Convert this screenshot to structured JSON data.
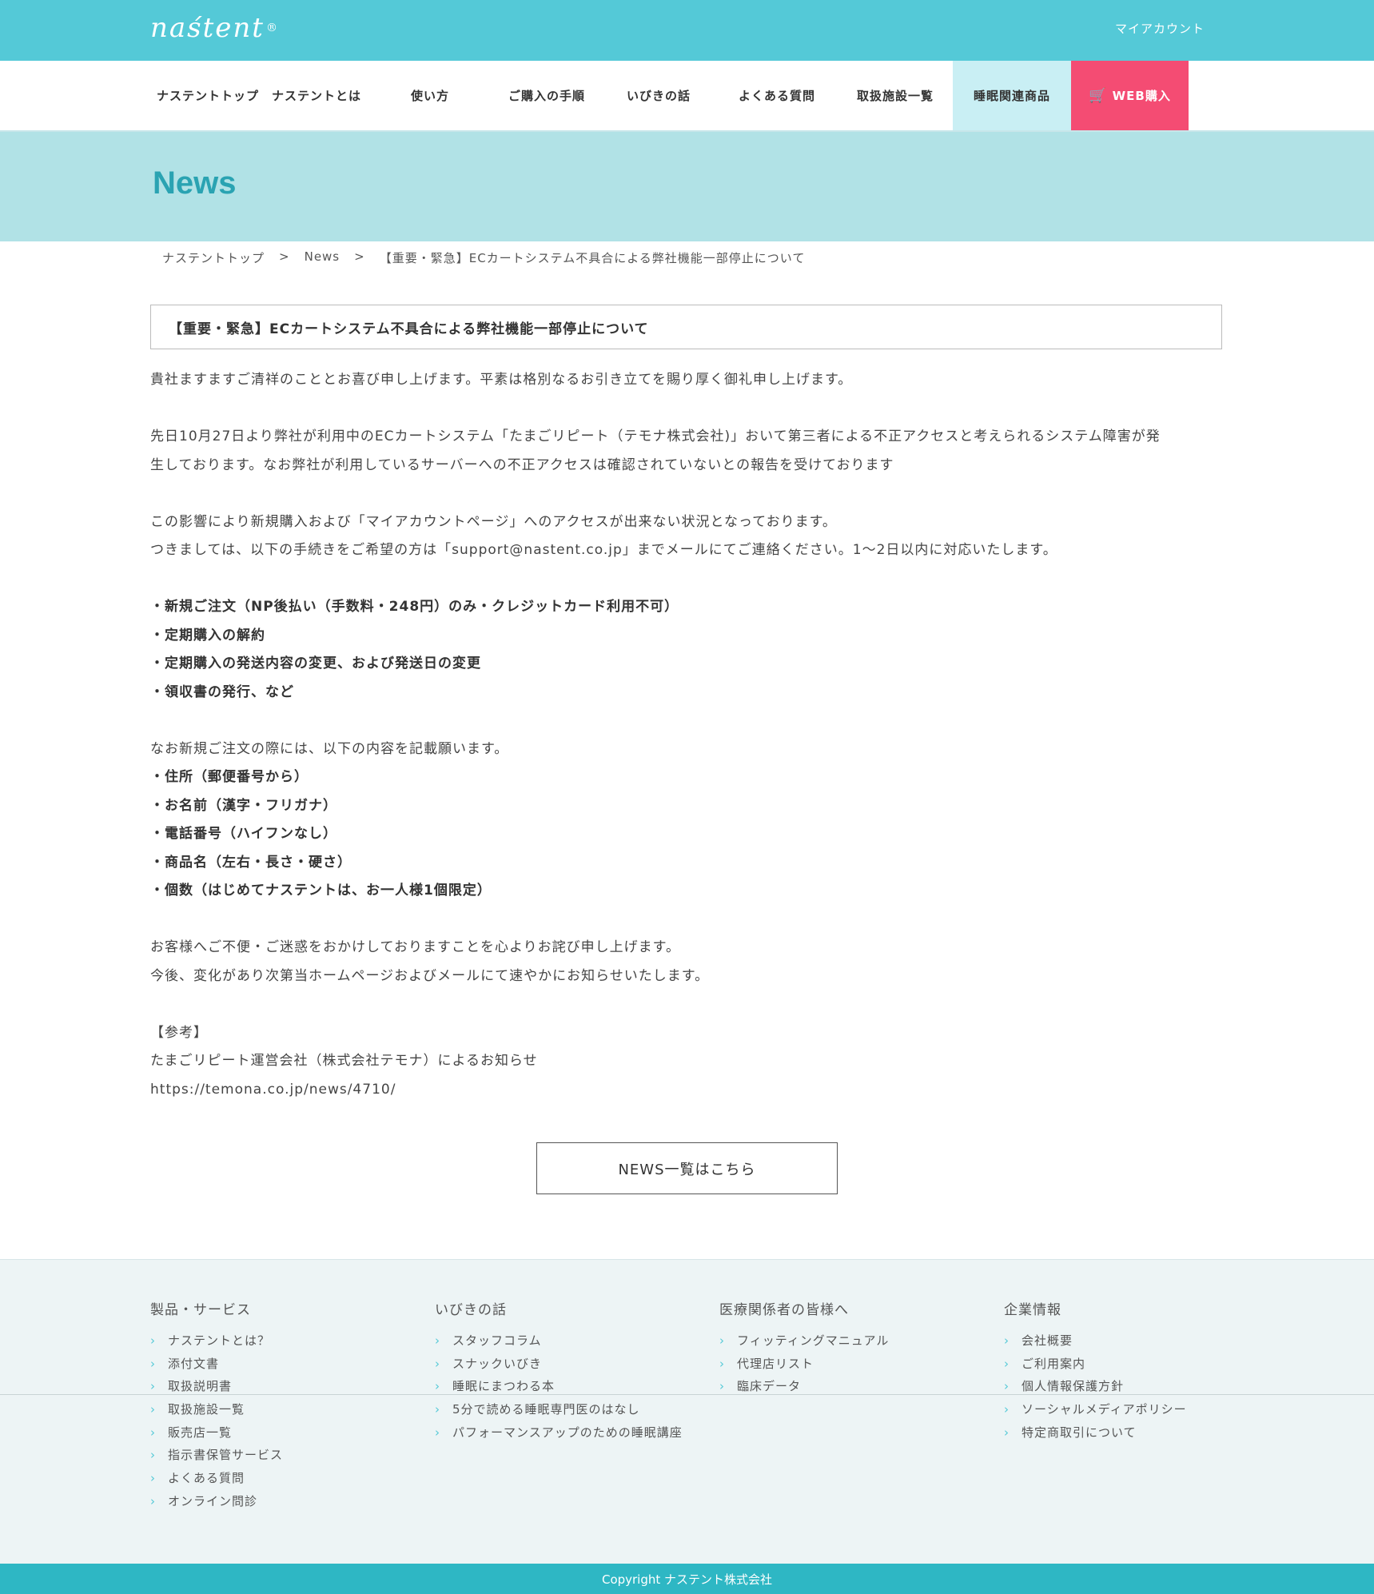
{
  "header": {
    "logo_text": "naśtent",
    "logo_mark": "®",
    "my_account": "マイアカウント"
  },
  "nav": {
    "items": [
      "ナステントトップ",
      "ナステントとは",
      "使い方",
      "ご購入の手順",
      "いびきの話",
      "よくある質問",
      "取扱施設一覧",
      "睡眠関連商品",
      "WEB購入"
    ]
  },
  "hero": {
    "title": "News"
  },
  "breadcrumb": {
    "items": [
      "ナステントトップ",
      "News",
      "【重要・緊急】ECカートシステム不具合による弊社機能一部停止について"
    ],
    "separator": ">"
  },
  "article": {
    "title": "【重要・緊急】ECカートシステム不具合による弊社機能一部停止について",
    "p1": "貴社ますますご清祥のこととお喜び申し上げます。平素は格別なるお引き立てを賜り厚く御礼申し上げます。",
    "p2a": "先日10月27日より弊社が利用中のECカートシステム「たまごリピート（テモナ株式会社)」おいて第三者による不正アクセスと考えられるシステム障害が発",
    "p2b": "生しております。なお弊社が利用しているサーバーへの不正アクセスは確認されていないとの報告を受けております",
    "p3a": "この影響により新規購入および「マイアカウントページ」へのアクセスが出来ない状況となっております。",
    "p3b": "つきましては、以下の手続きをご希望の方は「support@nastent.co.jp」までメールにてご連絡ください。1〜2日以内に対応いたします。",
    "list1": [
      "・新規ご注文（NP後払い（手数料・248円）のみ・クレジットカード利用不可）",
      "・定期購入の解約",
      "・定期購入の発送内容の変更、および発送日の変更",
      "・領収書の発行、など"
    ],
    "p4": "なお新規ご注文の際には、以下の内容を記載願います。",
    "list2": [
      "・住所（郵便番号から）",
      "・お名前（漢字・フリガナ）",
      "・電話番号（ハイフンなし）",
      "・商品名（左右・長さ・硬さ）",
      "・個数（はじめてナステントは、お一人様1個限定）"
    ],
    "p5a": "お客様へご不便・ご迷惑をおかけしておりますことを心よりお詫び申し上げます。",
    "p5b": "今後、変化があり次第当ホームページおよびメールにて速やかにお知らせいたします。",
    "ref_heading": "【参考】",
    "ref_text": "たまごリピート運営会社（株式会社テモナ）によるお知らせ",
    "ref_url": "https://temona.co.jp/news/4710/"
  },
  "news_button": "NEWS一覧はこちら",
  "footer": {
    "columns": [
      {
        "heading": "製品・サービス",
        "links": [
          "ナステントとは？",
          "添付文書",
          "取扱説明書",
          "取扱施設一覧",
          "販売店一覧",
          "指示書保管サービス",
          "よくある質問",
          "オンライン問診"
        ]
      },
      {
        "heading": "いびきの話",
        "links": [
          "スタッフコラム",
          "スナックいびき",
          "睡眠にまつわる本",
          "5分で読める睡眠専門医のはなし",
          "パフォーマンスアップのための睡眠講座"
        ]
      },
      {
        "heading": "医療関係者の皆様へ",
        "links": [
          "フィッティングマニュアル",
          "代理店リスト",
          "臨床データ"
        ]
      },
      {
        "heading": "企業情報",
        "links": [
          "会社概要",
          "ご利用案内",
          "個人情報保護方針",
          "ソーシャルメディアポリシー",
          "特定商取引について"
        ]
      }
    ],
    "copyright": "Copyright ナステント株式会社"
  },
  "colors": {
    "primary": "#54c9d7",
    "hero": "#b1e2e6",
    "web_button": "#f44c73",
    "sleep_tab": "#c9eff4",
    "footer_bar": "#2eb7c4"
  }
}
